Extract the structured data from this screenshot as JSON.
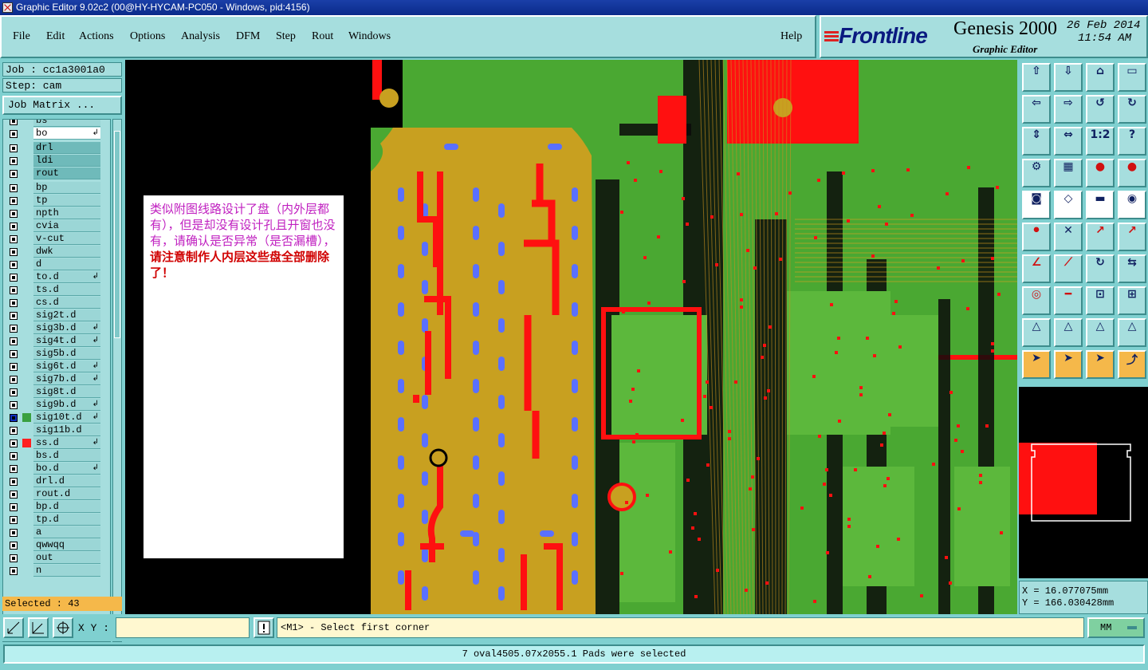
{
  "window": {
    "title": "Graphic Editor 9.02c2 (00@HY-HYCAM-PC050 - Windows, pid:4156)"
  },
  "menu": [
    {
      "label": "File",
      "underline": "F",
      "rest": "ile"
    },
    {
      "label": "Edit",
      "underline": "E",
      "rest": "dit"
    },
    {
      "label": "Actions",
      "underline": "A",
      "rest": "ctions"
    },
    {
      "label": "Options",
      "underline": "O",
      "rest": "ptions"
    },
    {
      "label": "Analysis",
      "underline": "A",
      "rest": "nalysis"
    },
    {
      "label": "DFM",
      "underline": "D",
      "rest": "FM"
    },
    {
      "label": "Step",
      "underline": "S",
      "rest": "tep"
    },
    {
      "label": "Rout",
      "underline": "R",
      "rest": "out"
    },
    {
      "label": "Windows",
      "underline": "W",
      "rest": "indows"
    },
    {
      "label": "Help",
      "underline": "",
      "rest": "Help"
    }
  ],
  "logo": {
    "brand": "Frontline",
    "product": "Genesis 2000",
    "subtitle": "Graphic Editor",
    "date": "26 Feb 2014",
    "time": "11:54 AM"
  },
  "left_panel": {
    "job": "Job : cc1a3001a0",
    "step": "Step: cam",
    "job_matrix_button": "Job Matrix ...",
    "selected": "Selected : 43",
    "layers": [
      {
        "name": "bs",
        "flag": ""
      },
      {
        "name": "bo",
        "flag": "↲"
      },
      {
        "name": "drl",
        "flag": ""
      },
      {
        "name": "ldi",
        "flag": ""
      },
      {
        "name": "rout",
        "flag": ""
      },
      {
        "name": "bp",
        "flag": ""
      },
      {
        "name": "tp",
        "flag": ""
      },
      {
        "name": "npth",
        "flag": ""
      },
      {
        "name": "cvia",
        "flag": ""
      },
      {
        "name": "v-cut",
        "flag": ""
      },
      {
        "name": "dwk",
        "flag": ""
      },
      {
        "name": "d",
        "flag": ""
      },
      {
        "name": "to.d",
        "flag": "↲"
      },
      {
        "name": "ts.d",
        "flag": ""
      },
      {
        "name": "cs.d",
        "flag": ""
      },
      {
        "name": "sig2t.d",
        "flag": ""
      },
      {
        "name": "sig3b.d",
        "flag": "↲"
      },
      {
        "name": "sig4t.d",
        "flag": "↲"
      },
      {
        "name": "sig5b.d",
        "flag": ""
      },
      {
        "name": "sig6t.d",
        "flag": "↲"
      },
      {
        "name": "sig7b.d",
        "flag": "↲"
      },
      {
        "name": "sig8t.d",
        "flag": ""
      },
      {
        "name": "sig9b.d",
        "flag": "↲"
      },
      {
        "name": "sig10t.d",
        "flag": "↲"
      },
      {
        "name": "sig11b.d",
        "flag": ""
      },
      {
        "name": "ss.d",
        "flag": "↲"
      },
      {
        "name": "bs.d",
        "flag": ""
      },
      {
        "name": "bo.d",
        "flag": "↲"
      },
      {
        "name": "drl.d",
        "flag": ""
      },
      {
        "name": "rout.d",
        "flag": ""
      },
      {
        "name": "bp.d",
        "flag": ""
      },
      {
        "name": "tp.d",
        "flag": ""
      },
      {
        "name": "a",
        "flag": ""
      },
      {
        "name": "qwwqq",
        "flag": ""
      },
      {
        "name": "out",
        "flag": ""
      },
      {
        "name": "n",
        "flag": ""
      }
    ]
  },
  "note": {
    "text_purple": "类似附图线路设计了盘（内外层都有），但是却没有设计孔且开窗也没有，请确认是否异常（是否漏槽），",
    "text_red": "请注意制作人内层这些盘全部删除了！"
  },
  "coords": {
    "x": "X = 16.077075mm",
    "y": "Y = 166.030428mm"
  },
  "bottom": {
    "xy_label": "X Y :",
    "xy_value": "",
    "prompt": "<M1> - Select first corner",
    "units": "MM",
    "status": "7 oval4505.07x2055.1 Pads were selected"
  },
  "colors": {
    "copper": "#4aa832",
    "board": "#c8a020",
    "trace_red": "#ff1010",
    "pad_blue": "#5a70ff",
    "panel": "#a6dede",
    "status_orange": "#f5b84a"
  }
}
